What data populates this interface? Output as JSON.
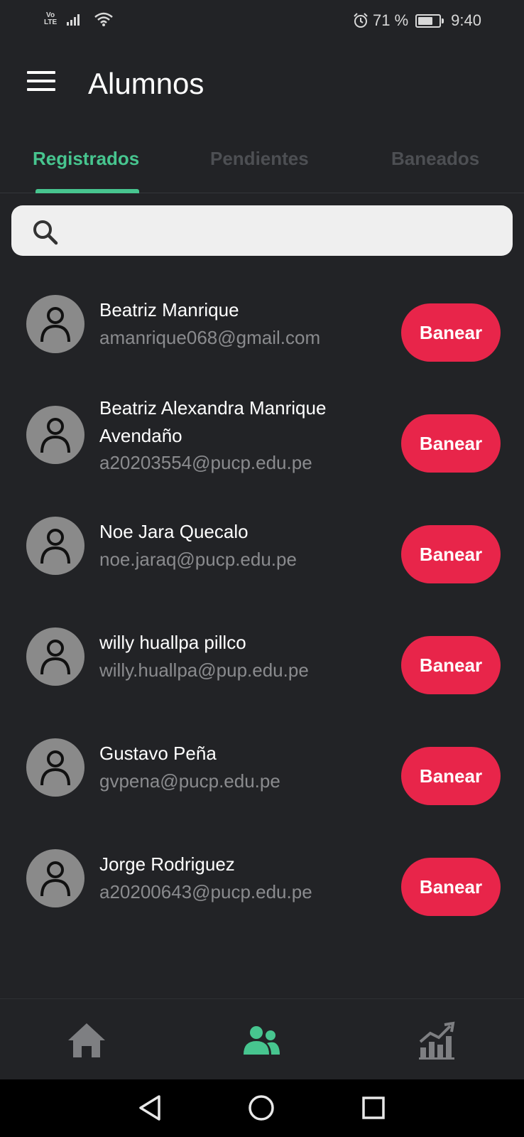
{
  "status_bar": {
    "network": "Vo\nLTE",
    "battery_text": "71 %",
    "battery_level": 0.71,
    "time": "9:40"
  },
  "app_bar": {
    "title": "Alumnos"
  },
  "tabs": [
    {
      "label": "Registrados",
      "active": true
    },
    {
      "label": "Pendientes",
      "active": false
    },
    {
      "label": "Baneados",
      "active": false
    }
  ],
  "search": {
    "placeholder": "",
    "value": ""
  },
  "students": [
    {
      "name": "Beatriz Manrique",
      "email": "amanrique068@gmail.com",
      "action": "Banear"
    },
    {
      "name": "Beatriz Alexandra Manrique Avendaño",
      "email": "a20203554@pucp.edu.pe",
      "action": "Banear"
    },
    {
      "name": "Noe Jara Quecalo",
      "email": "noe.jaraq@pucp.edu.pe",
      "action": "Banear"
    },
    {
      "name": "willy huallpa pillco",
      "email": "willy.huallpa@pup.edu.pe",
      "action": "Banear"
    },
    {
      "name": "Gustavo Peña",
      "email": "gvpena@pucp.edu.pe",
      "action": "Banear"
    },
    {
      "name": "Jorge Rodriguez",
      "email": "a20200643@pucp.edu.pe",
      "action": "Banear"
    }
  ],
  "bottom_nav": [
    {
      "icon": "home-icon",
      "active": false
    },
    {
      "icon": "users-icon",
      "active": true
    },
    {
      "icon": "chart-icon",
      "active": false
    }
  ],
  "colors": {
    "background": "#222326",
    "accent": "#47c58f",
    "ban_button": "#e8254a",
    "inactive_tab": "#4d4f53",
    "secondary_text": "#8a8b8e"
  }
}
